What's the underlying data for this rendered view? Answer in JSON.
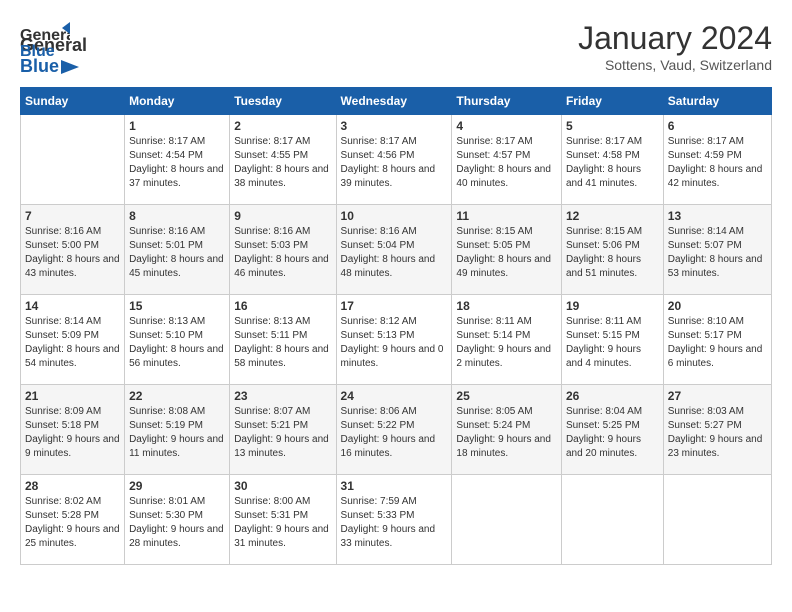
{
  "header": {
    "logo_general": "General",
    "logo_blue": "Blue",
    "month": "January 2024",
    "location": "Sottens, Vaud, Switzerland"
  },
  "days_of_week": [
    "Sunday",
    "Monday",
    "Tuesday",
    "Wednesday",
    "Thursday",
    "Friday",
    "Saturday"
  ],
  "weeks": [
    [
      {
        "day": "",
        "sunrise": "",
        "sunset": "",
        "daylight": ""
      },
      {
        "day": "1",
        "sunrise": "Sunrise: 8:17 AM",
        "sunset": "Sunset: 4:54 PM",
        "daylight": "Daylight: 8 hours and 37 minutes."
      },
      {
        "day": "2",
        "sunrise": "Sunrise: 8:17 AM",
        "sunset": "Sunset: 4:55 PM",
        "daylight": "Daylight: 8 hours and 38 minutes."
      },
      {
        "day": "3",
        "sunrise": "Sunrise: 8:17 AM",
        "sunset": "Sunset: 4:56 PM",
        "daylight": "Daylight: 8 hours and 39 minutes."
      },
      {
        "day": "4",
        "sunrise": "Sunrise: 8:17 AM",
        "sunset": "Sunset: 4:57 PM",
        "daylight": "Daylight: 8 hours and 40 minutes."
      },
      {
        "day": "5",
        "sunrise": "Sunrise: 8:17 AM",
        "sunset": "Sunset: 4:58 PM",
        "daylight": "Daylight: 8 hours and 41 minutes."
      },
      {
        "day": "6",
        "sunrise": "Sunrise: 8:17 AM",
        "sunset": "Sunset: 4:59 PM",
        "daylight": "Daylight: 8 hours and 42 minutes."
      }
    ],
    [
      {
        "day": "7",
        "sunrise": "Sunrise: 8:16 AM",
        "sunset": "Sunset: 5:00 PM",
        "daylight": "Daylight: 8 hours and 43 minutes."
      },
      {
        "day": "8",
        "sunrise": "Sunrise: 8:16 AM",
        "sunset": "Sunset: 5:01 PM",
        "daylight": "Daylight: 8 hours and 45 minutes."
      },
      {
        "day": "9",
        "sunrise": "Sunrise: 8:16 AM",
        "sunset": "Sunset: 5:03 PM",
        "daylight": "Daylight: 8 hours and 46 minutes."
      },
      {
        "day": "10",
        "sunrise": "Sunrise: 8:16 AM",
        "sunset": "Sunset: 5:04 PM",
        "daylight": "Daylight: 8 hours and 48 minutes."
      },
      {
        "day": "11",
        "sunrise": "Sunrise: 8:15 AM",
        "sunset": "Sunset: 5:05 PM",
        "daylight": "Daylight: 8 hours and 49 minutes."
      },
      {
        "day": "12",
        "sunrise": "Sunrise: 8:15 AM",
        "sunset": "Sunset: 5:06 PM",
        "daylight": "Daylight: 8 hours and 51 minutes."
      },
      {
        "day": "13",
        "sunrise": "Sunrise: 8:14 AM",
        "sunset": "Sunset: 5:07 PM",
        "daylight": "Daylight: 8 hours and 53 minutes."
      }
    ],
    [
      {
        "day": "14",
        "sunrise": "Sunrise: 8:14 AM",
        "sunset": "Sunset: 5:09 PM",
        "daylight": "Daylight: 8 hours and 54 minutes."
      },
      {
        "day": "15",
        "sunrise": "Sunrise: 8:13 AM",
        "sunset": "Sunset: 5:10 PM",
        "daylight": "Daylight: 8 hours and 56 minutes."
      },
      {
        "day": "16",
        "sunrise": "Sunrise: 8:13 AM",
        "sunset": "Sunset: 5:11 PM",
        "daylight": "Daylight: 8 hours and 58 minutes."
      },
      {
        "day": "17",
        "sunrise": "Sunrise: 8:12 AM",
        "sunset": "Sunset: 5:13 PM",
        "daylight": "Daylight: 9 hours and 0 minutes."
      },
      {
        "day": "18",
        "sunrise": "Sunrise: 8:11 AM",
        "sunset": "Sunset: 5:14 PM",
        "daylight": "Daylight: 9 hours and 2 minutes."
      },
      {
        "day": "19",
        "sunrise": "Sunrise: 8:11 AM",
        "sunset": "Sunset: 5:15 PM",
        "daylight": "Daylight: 9 hours and 4 minutes."
      },
      {
        "day": "20",
        "sunrise": "Sunrise: 8:10 AM",
        "sunset": "Sunset: 5:17 PM",
        "daylight": "Daylight: 9 hours and 6 minutes."
      }
    ],
    [
      {
        "day": "21",
        "sunrise": "Sunrise: 8:09 AM",
        "sunset": "Sunset: 5:18 PM",
        "daylight": "Daylight: 9 hours and 9 minutes."
      },
      {
        "day": "22",
        "sunrise": "Sunrise: 8:08 AM",
        "sunset": "Sunset: 5:19 PM",
        "daylight": "Daylight: 9 hours and 11 minutes."
      },
      {
        "day": "23",
        "sunrise": "Sunrise: 8:07 AM",
        "sunset": "Sunset: 5:21 PM",
        "daylight": "Daylight: 9 hours and 13 minutes."
      },
      {
        "day": "24",
        "sunrise": "Sunrise: 8:06 AM",
        "sunset": "Sunset: 5:22 PM",
        "daylight": "Daylight: 9 hours and 16 minutes."
      },
      {
        "day": "25",
        "sunrise": "Sunrise: 8:05 AM",
        "sunset": "Sunset: 5:24 PM",
        "daylight": "Daylight: 9 hours and 18 minutes."
      },
      {
        "day": "26",
        "sunrise": "Sunrise: 8:04 AM",
        "sunset": "Sunset: 5:25 PM",
        "daylight": "Daylight: 9 hours and 20 minutes."
      },
      {
        "day": "27",
        "sunrise": "Sunrise: 8:03 AM",
        "sunset": "Sunset: 5:27 PM",
        "daylight": "Daylight: 9 hours and 23 minutes."
      }
    ],
    [
      {
        "day": "28",
        "sunrise": "Sunrise: 8:02 AM",
        "sunset": "Sunset: 5:28 PM",
        "daylight": "Daylight: 9 hours and 25 minutes."
      },
      {
        "day": "29",
        "sunrise": "Sunrise: 8:01 AM",
        "sunset": "Sunset: 5:30 PM",
        "daylight": "Daylight: 9 hours and 28 minutes."
      },
      {
        "day": "30",
        "sunrise": "Sunrise: 8:00 AM",
        "sunset": "Sunset: 5:31 PM",
        "daylight": "Daylight: 9 hours and 31 minutes."
      },
      {
        "day": "31",
        "sunrise": "Sunrise: 7:59 AM",
        "sunset": "Sunset: 5:33 PM",
        "daylight": "Daylight: 9 hours and 33 minutes."
      },
      {
        "day": "",
        "sunrise": "",
        "sunset": "",
        "daylight": ""
      },
      {
        "day": "",
        "sunrise": "",
        "sunset": "",
        "daylight": ""
      },
      {
        "day": "",
        "sunrise": "",
        "sunset": "",
        "daylight": ""
      }
    ]
  ]
}
